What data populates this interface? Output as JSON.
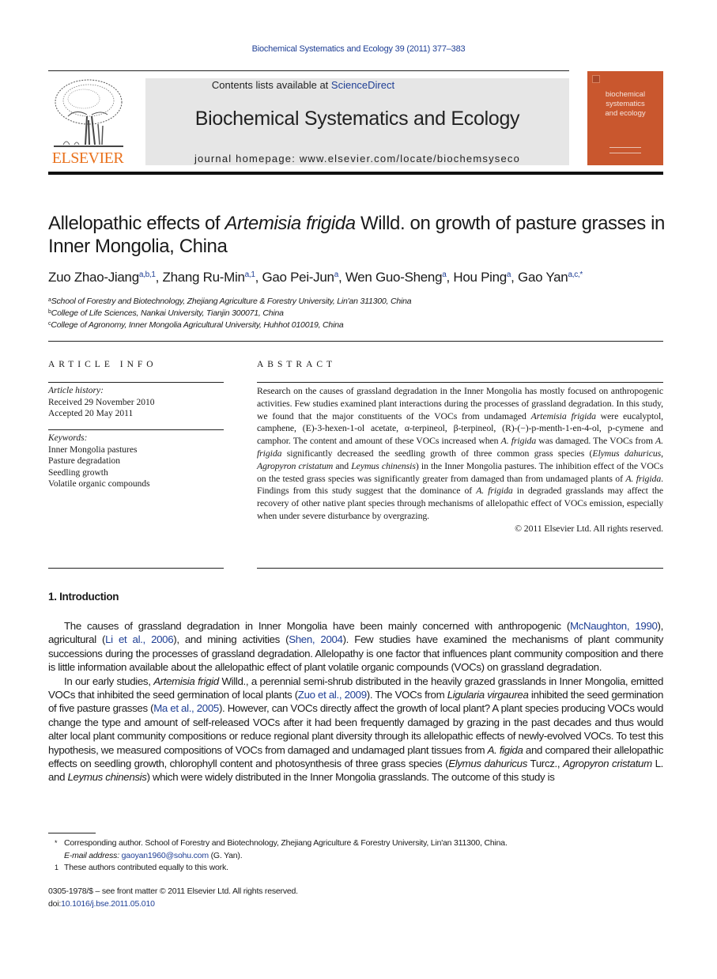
{
  "running_head": "Biochemical Systematics and Ecology 39 (2011) 377–383",
  "header": {
    "publisher_logo_text": "ELSEVIER",
    "contents_prefix": "Contents lists available at ",
    "contents_link": "ScienceDirect",
    "journal_title": "Biochemical Systematics and Ecology",
    "homepage": "journal homepage: www.elsevier.com/locate/biochemsyseco",
    "cover_lines": [
      "biochemical",
      "systematics",
      "and ecology"
    ],
    "cover_color": "#c9572e",
    "logo_color": "#e9711c"
  },
  "article": {
    "title_pre": "Allelopathic effects of ",
    "title_italic": "Artemisia frigida",
    "title_post": " Willd. on growth of pasture grasses in Inner Mongolia, China",
    "authors": [
      {
        "name": "Zuo Zhao-Jiang",
        "sup": "a,b,1"
      },
      {
        "name": "Zhang Ru-Min",
        "sup": "a,1"
      },
      {
        "name": "Gao Pei-Jun",
        "sup": "a"
      },
      {
        "name": "Wen Guo-Sheng",
        "sup": "a"
      },
      {
        "name": "Hou Ping",
        "sup": "a"
      },
      {
        "name": "Gao Yan",
        "sup": "a,c,*"
      }
    ],
    "affiliations": [
      {
        "mark": "a",
        "text": "School of Forestry and Biotechnology, Zhejiang Agriculture & Forestry University, Lin'an 311300, China"
      },
      {
        "mark": "b",
        "text": "College of Life Sciences, Nankai University, Tianjin 300071, China"
      },
      {
        "mark": "c",
        "text": "College of Agronomy, Inner Mongolia Agricultural University, Huhhot 010019, China"
      }
    ]
  },
  "article_info": {
    "heading": "ARTICLE INFO",
    "history_label": "Article history:",
    "received": "Received 29 November 2010",
    "accepted": "Accepted 20 May 2011",
    "keywords_label": "Keywords:",
    "keywords": [
      "Inner Mongolia pastures",
      "Pasture degradation",
      "Seedling growth",
      "Volatile organic compounds"
    ]
  },
  "abstract": {
    "heading": "ABSTRACT",
    "text_1": "Research on the causes of grassland degradation in the Inner Mongolia has mostly focused on anthropogenic activities. Few studies examined plant interactions during the processes of grassland degradation. In this study, we found that the major constituents of the VOCs from undamaged ",
    "i_1": "Artemisia frigida",
    "text_2": " were eucalyptol, camphene, (E)-3-hexen-1-ol acetate, α-terpineol, β-terpineol, (R)-(−)-p-menth-1-en-4-ol, p-cymene and camphor. The content and amount of these VOCs increased when ",
    "i_2": "A. frigida",
    "text_3": " was damaged. The VOCs from ",
    "i_3": "A. frigida",
    "text_4": " significantly decreased the seedling growth of three common grass species (",
    "i_4": "Elymus dahuricus",
    "text_5": ", ",
    "i_5": "Agropyron cristatum",
    "text_6": " and ",
    "i_6": "Leymus chinensis",
    "text_7": ") in the Inner Mongolia pastures. The inhibition effect of the VOCs on the tested grass species was significantly greater from damaged than from undamaged plants of ",
    "i_7": "A. frigida",
    "text_8": ". Findings from this study suggest that the dominance of ",
    "i_8": "A. frigida",
    "text_9": " in degraded grasslands may affect the recovery of other native plant species through mechanisms of allelopathic effect of VOCs emission, especially when under severe disturbance by overgrazing.",
    "copyright": "© 2011 Elsevier Ltd. All rights reserved."
  },
  "introduction": {
    "heading": "1.  Introduction",
    "p1": {
      "t1": "The causes of grassland degradation in Inner Mongolia have been mainly concerned with anthropogenic (",
      "c1": "McNaughton, 1990",
      "t2": "), agricultural (",
      "c2": "Li et al., 2006",
      "t3": "), and mining activities (",
      "c3": "Shen, 2004",
      "t4": "). Few studies have examined the mechanisms of plant community successions during the processes of grassland degradation. Allelopathy is one factor that influences plant community composition and there is little information available about the allelopathic effect of plant volatile organic compounds (VOCs) on grassland degradation."
    },
    "p2": {
      "t1": "In our early studies, ",
      "i1": "Artemisia frigid",
      "t2": " Willd., a perennial semi-shrub distributed in the heavily grazed grasslands in Inner Mongolia, emitted VOCs that inhibited the seed germination of local plants (",
      "c1": "Zuo et al., 2009",
      "t3": "). The VOCs from ",
      "i2": "Ligularia virgaurea",
      "t4": " inhibited the seed germination of five pasture grasses (",
      "c2": "Ma et al., 2005",
      "t5": "). However, can VOCs directly affect the growth of local plant? A plant species producing VOCs would change the type and amount of self-released VOCs after it had been frequently damaged by grazing in the past decades and thus would alter local plant community compositions or reduce regional plant diversity through its allelopathic effects of newly-evolved VOCs. To test this hypothesis, we measured compositions of VOCs from damaged and undamaged plant tissues from ",
      "i3": "A. figida",
      "t6": " and compared their allelopathic effects on seedling growth, chlorophyll content and photosynthesis of three grass species (",
      "i4": "Elymus dahuricus",
      "t7": " Turcz., ",
      "i5": "Agropyron cristatum",
      "t8": " L. and ",
      "i6": "Leymus chinensis",
      "t9": ") which were widely distributed in the Inner Mongolia grasslands. The outcome of this study is"
    }
  },
  "footnotes": {
    "corr_mark": "*",
    "corr_text": "Corresponding author. School of Forestry and Biotechnology, Zhejiang Agriculture & Forestry University, Lin'an 311300, China.",
    "email_label": "E-mail address:",
    "email": "gaoyan1960@sohu.com",
    "email_suffix": " (G. Yan).",
    "eq_mark": "1",
    "eq_text": "These authors contributed equally to this work."
  },
  "bottom": {
    "issn": "0305-1978/$ – see front matter © 2011 Elsevier Ltd. All rights reserved.",
    "doi_prefix": "doi:",
    "doi": "10.1016/j.bse.2011.05.010"
  }
}
